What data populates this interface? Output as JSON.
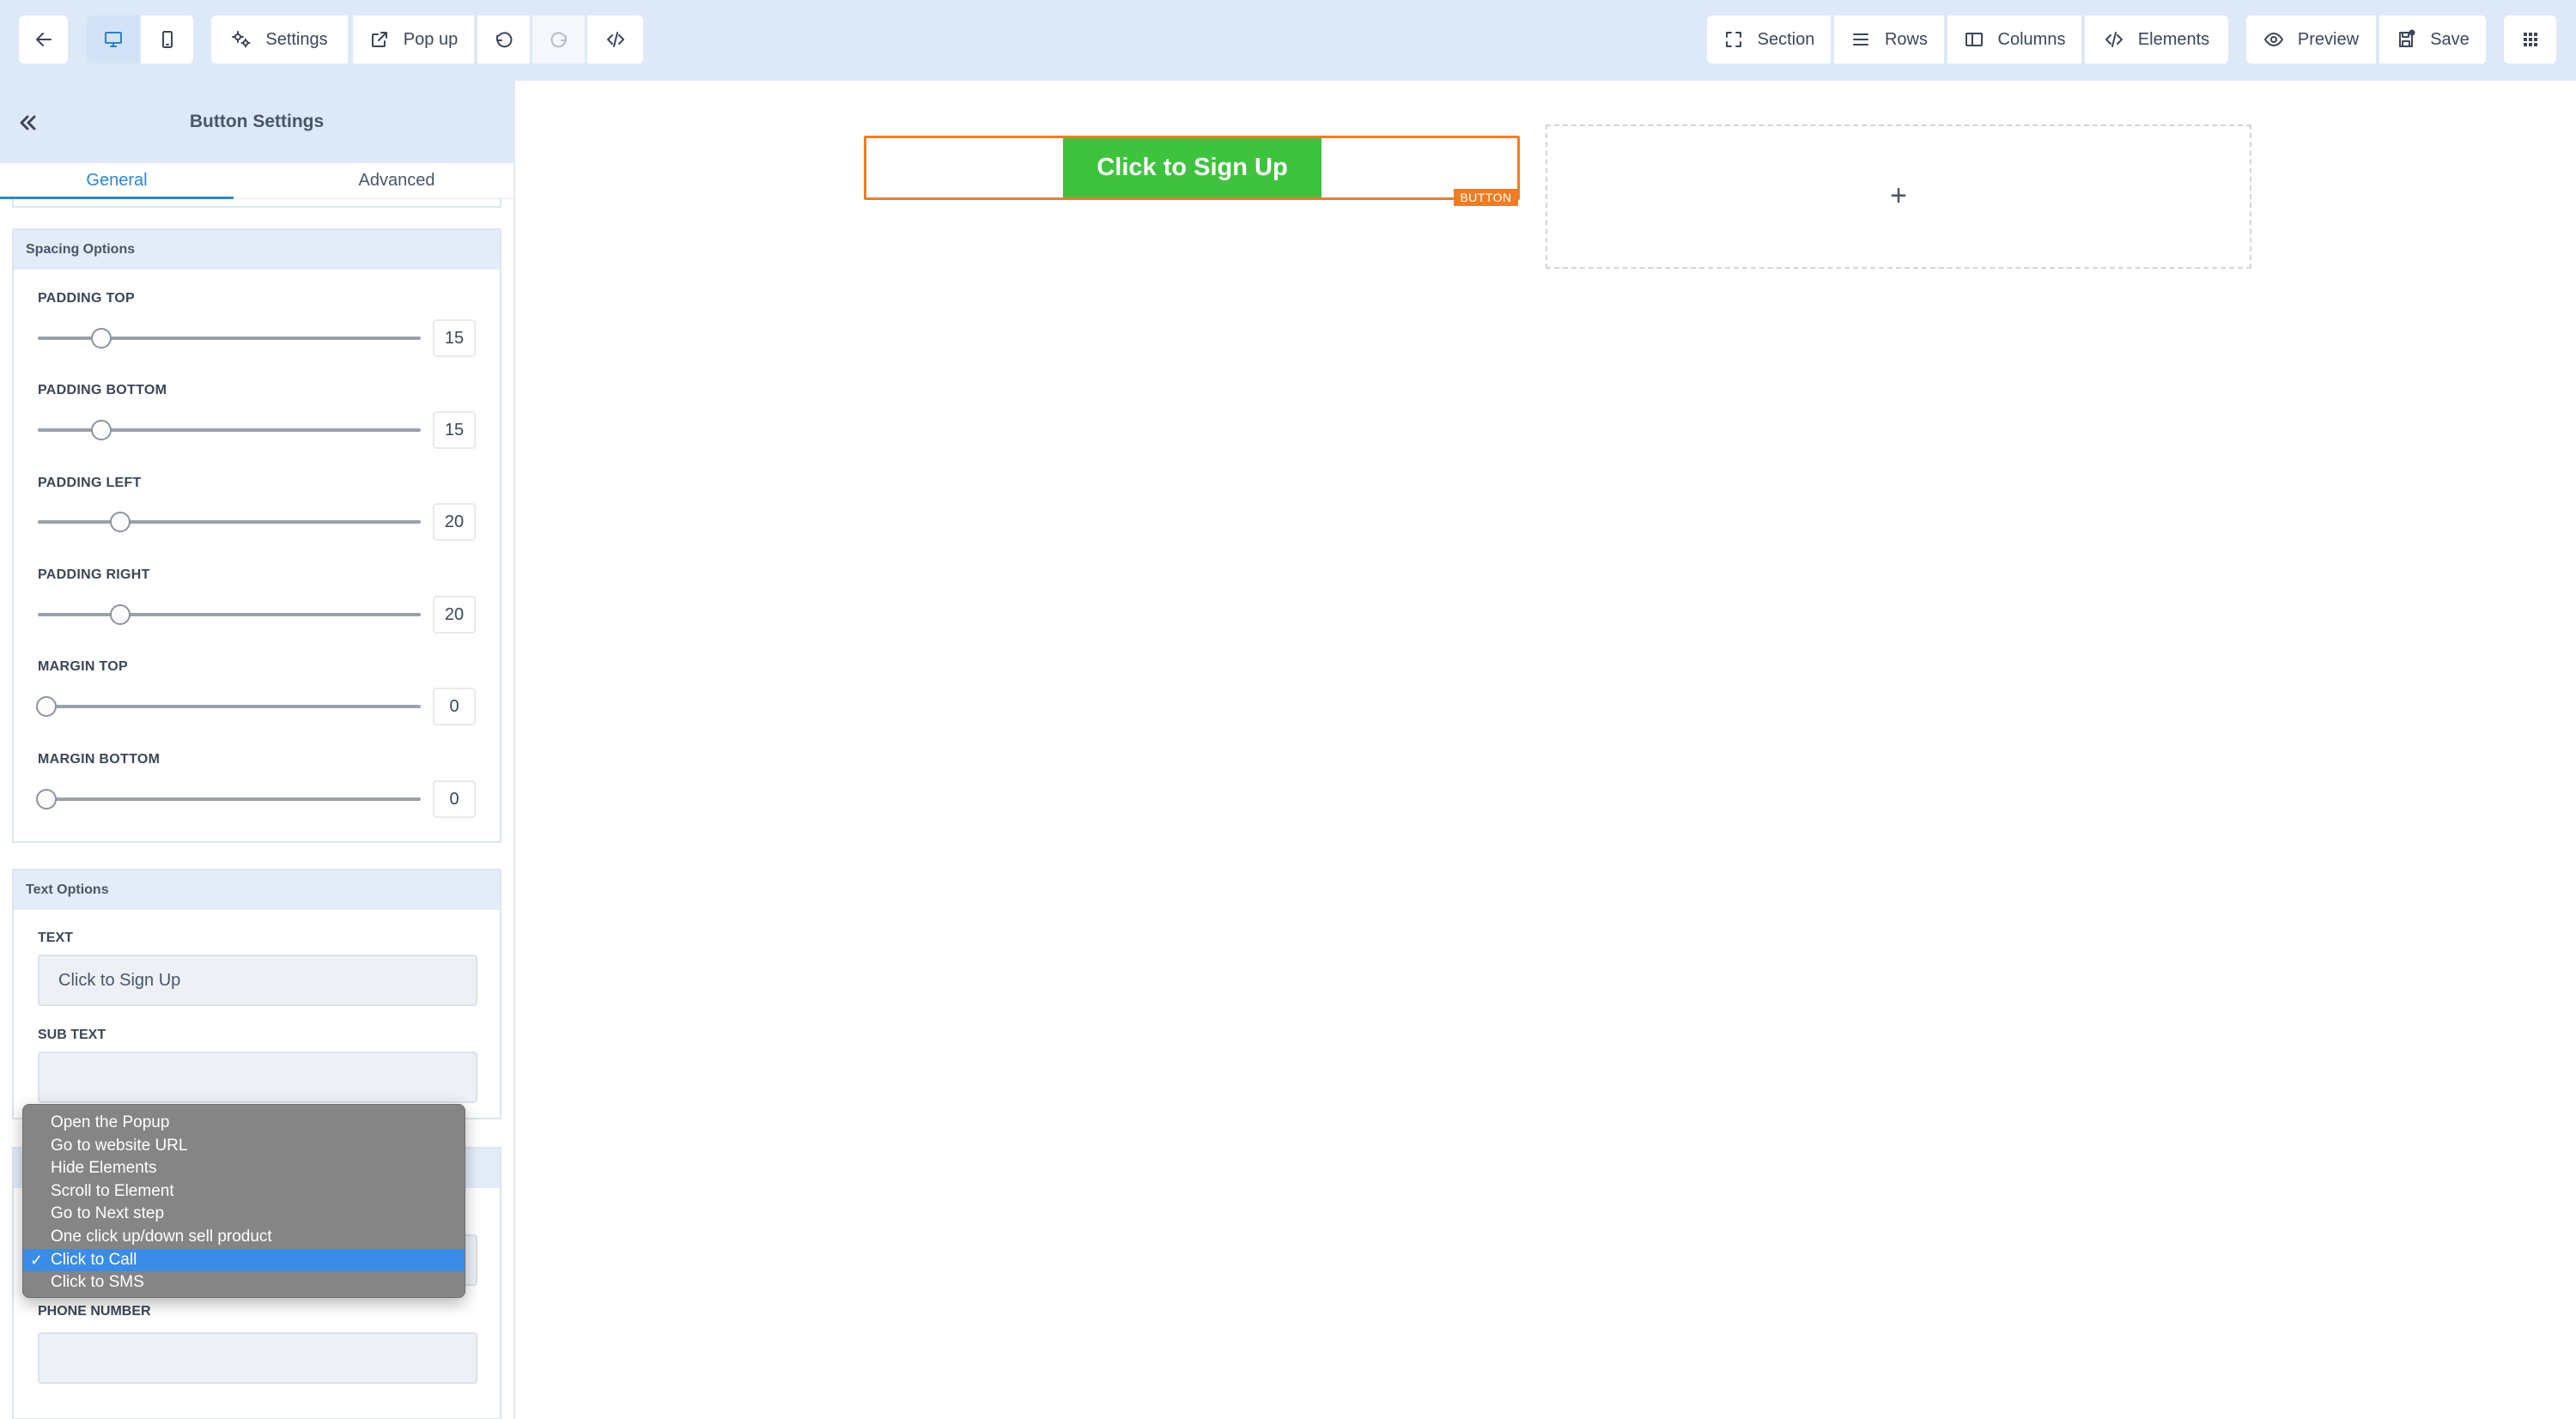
{
  "toolbar": {
    "settings_label": "Settings",
    "popup_label": "Pop up",
    "section_label": "Section",
    "rows_label": "Rows",
    "columns_label": "Columns",
    "elements_label": "Elements",
    "preview_label": "Preview",
    "save_label": "Save"
  },
  "panel": {
    "title": "Button Settings",
    "tabs": [
      "General",
      "Advanced"
    ],
    "active_tab": "General",
    "spacing": {
      "header": "Spacing Options",
      "sliders": [
        {
          "label": "PADDING TOP",
          "value": "15"
        },
        {
          "label": "PADDING BOTTOM",
          "value": "15"
        },
        {
          "label": "PADDING LEFT",
          "value": "20"
        },
        {
          "label": "PADDING RIGHT",
          "value": "20"
        },
        {
          "label": "MARGIN TOP",
          "value": "0"
        },
        {
          "label": "MARGIN BOTTOM",
          "value": "0"
        }
      ]
    },
    "text_options": {
      "header": "Text Options",
      "text_label": "TEXT",
      "text_value": "Click to Sign Up",
      "subtext_label": "SUB TEXT",
      "subtext_value": ""
    },
    "action": {
      "phone_label": "PHONE NUMBER",
      "phone_value": "",
      "options": [
        "Open the Popup",
        "Go to website URL",
        "Hide Elements",
        "Scroll to Element",
        "Go to Next step",
        "One click up/down sell product",
        "Click to Call",
        "Click to SMS"
      ],
      "selected": "Click to Call"
    }
  },
  "canvas": {
    "button_text": "Click to Sign Up",
    "button_tag": "BUTTON",
    "add_symbol": "+"
  },
  "colors": {
    "accent": "#2b86d8",
    "button_green": "#3fc33f",
    "selection_orange": "#f07d24",
    "toolbar_bg": "#dde9f8"
  }
}
